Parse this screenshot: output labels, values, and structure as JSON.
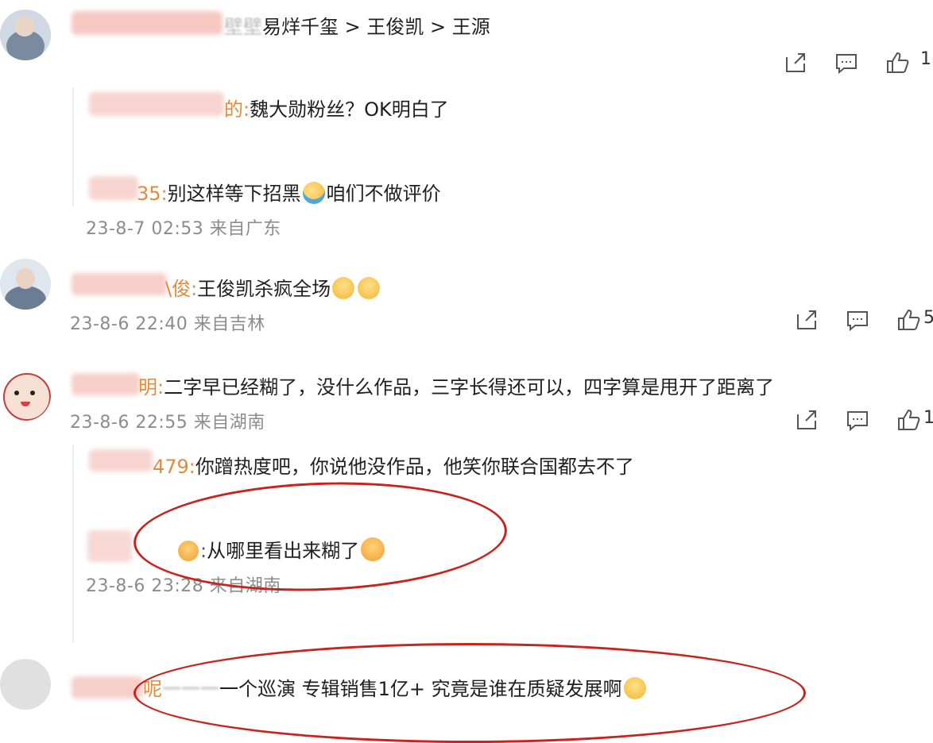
{
  "comment1": {
    "text": "易烊千玺 > 王俊凯 > 王源",
    "name_fragment": "壁壁",
    "actions": {
      "count_fragment": "1("
    }
  },
  "comment1_replies": [
    {
      "name_fragment": "的:",
      "text": "魏大勋粉丝？OK明白了"
    },
    {
      "name_fragment": "35:",
      "text_a": "别这样等下招黑",
      "text_b": "咱们不做评价"
    }
  ],
  "comment1_meta": "23-8-7 02:53 来自广东",
  "comment2": {
    "name_fragment": "\\俊:",
    "text": "王俊凯杀疯全场",
    "meta": "23-8-6 22:40 来自吉林",
    "count_fragment": "5"
  },
  "comment3": {
    "name_fragment": "明:",
    "text": "二字早已经糊了，没什么作品，三字长得还可以，四字算是甩开了距离了",
    "meta": "23-8-6 22:55 来自湖南",
    "count_fragment": "1"
  },
  "comment3_replies": [
    {
      "name_fragment": "479:",
      "text": "你蹭热度吧，你说他没作品，他笑你联合国都去不了"
    },
    {
      "name_fragment": ":",
      "text": "从哪里看出来糊了"
    }
  ],
  "comment3_meta": "23-8-6 23:28 来自湖南",
  "comment4": {
    "name_fragment": "呢",
    "text": "一个巡演 专辑销售1亿+ 究竟是谁在质疑发展啊"
  },
  "colors": {
    "highlight": "#c8231d",
    "name": "#e48a38",
    "meta": "#8c8c8c"
  },
  "icons": [
    "share-icon",
    "comment-icon",
    "like-icon"
  ]
}
